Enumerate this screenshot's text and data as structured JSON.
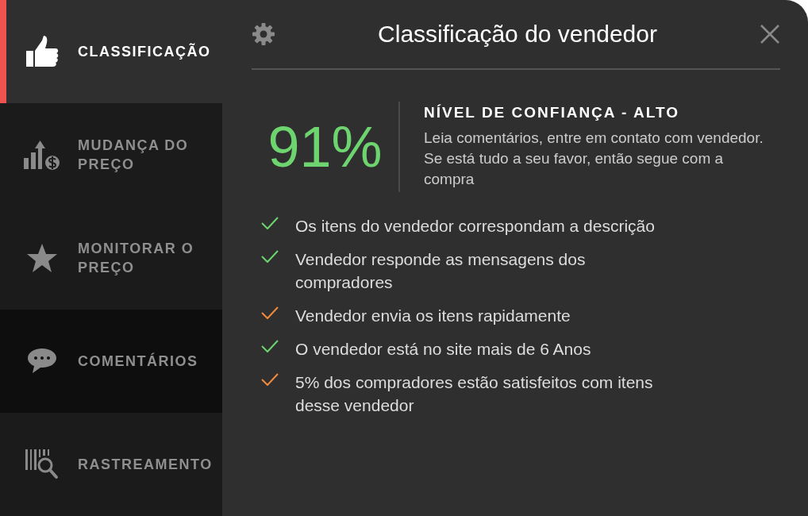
{
  "sidebar": {
    "items": [
      {
        "kind": "thumb",
        "label": "CLASSIFICAÇÃO",
        "selected": true,
        "highlighted": false
      },
      {
        "kind": "price",
        "label": "MUDANÇA DO PREÇO",
        "selected": false,
        "highlighted": false
      },
      {
        "kind": "star",
        "label": "MONITORAR O PREÇO",
        "selected": false,
        "highlighted": false
      },
      {
        "kind": "chat",
        "label": "COMENTÁRIOS",
        "selected": false,
        "highlighted": true
      },
      {
        "kind": "barcode",
        "label": "RASTREAMENTO",
        "selected": false,
        "highlighted": false
      }
    ]
  },
  "header": {
    "title": "Classificação do vendedor"
  },
  "score": {
    "value": "91%",
    "heading": "NÍVEL DE CONFIANÇA - ALTO",
    "text": "Leia comentários, entre em contato com vendedor. Se está tudo a seu favor, então segue com a compra"
  },
  "checks": [
    {
      "text": "Os itens do vendedor correspondam a descrição",
      "color": "#6dd46f"
    },
    {
      "text": "Vendedor responde as mensagens dos compradores",
      "color": "#6dd46f"
    },
    {
      "text": "Vendedor envia os itens rapidamente",
      "color": "#f08a3c"
    },
    {
      "text": "O vendedor está no site mais de 6 Anos",
      "color": "#6dd46f"
    },
    {
      "text": "5% dos compradores estão satisfeitos com itens desse vendedor",
      "color": "#f08a3c"
    }
  ]
}
